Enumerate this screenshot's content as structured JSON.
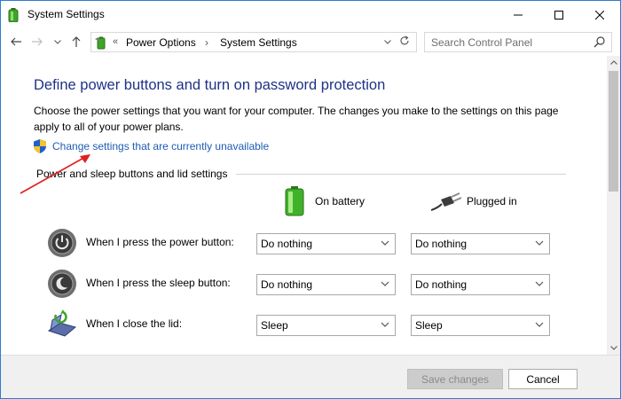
{
  "window": {
    "title": "System Settings",
    "accent_color": "#2b7cd3",
    "controls": {
      "minimize_icon": "minimize-icon",
      "maximize_icon": "maximize-icon",
      "close_icon": "close-icon"
    }
  },
  "address_bar": {
    "breadcrumb": [
      "Power Options",
      "System Settings"
    ],
    "overflow_glyph": "«",
    "separator_glyph": "›",
    "search_placeholder": "Search Control Panel"
  },
  "content": {
    "heading": "Define power buttons and turn on password protection",
    "description": "Choose the power settings that you want for your computer. The changes you make to the settings on this page apply to all of your power plans.",
    "change_link": "Change settings that are currently unavailable",
    "section_title": "Power and sleep buttons and lid settings",
    "columns": {
      "battery": "On battery",
      "plugged": "Plugged in"
    },
    "rows": [
      {
        "label": "When I press the power button:",
        "battery": "Do nothing",
        "plugged": "Do nothing",
        "icon": "power-button-icon"
      },
      {
        "label": "When I press the sleep button:",
        "battery": "Do nothing",
        "plugged": "Do nothing",
        "icon": "sleep-button-icon"
      },
      {
        "label": "When I close the lid:",
        "battery": "Sleep",
        "plugged": "Sleep",
        "icon": "laptop-lid-icon"
      }
    ]
  },
  "footer": {
    "save_label": "Save changes",
    "cancel_label": "Cancel"
  },
  "colors": {
    "heading": "#1e3287",
    "link": "#1e5bb5",
    "annotation_arrow": "#e02020"
  }
}
